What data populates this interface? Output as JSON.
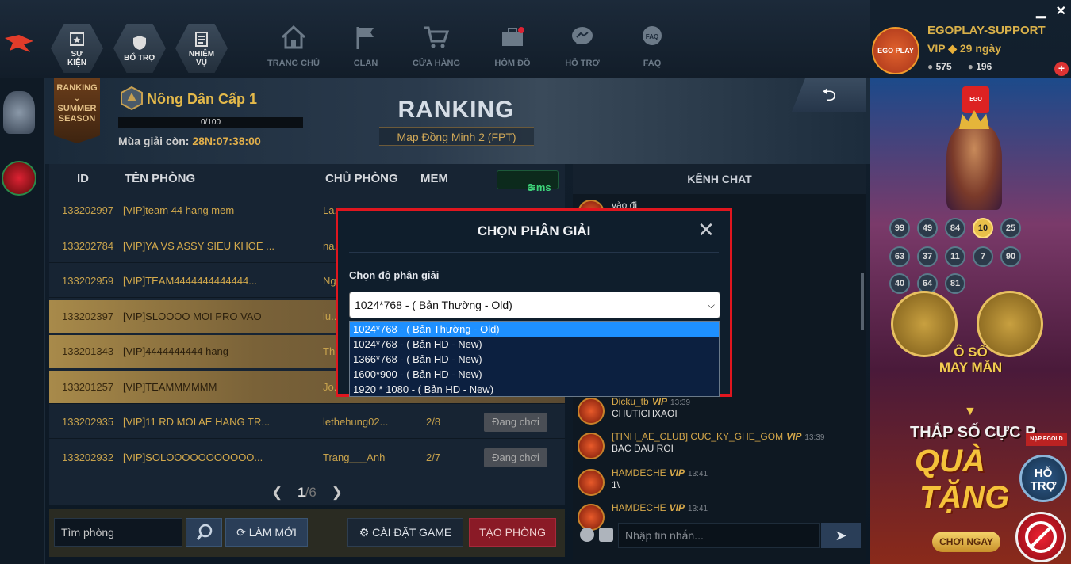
{
  "window": {
    "minimize": "▁",
    "close": "✕"
  },
  "hex_buttons": [
    {
      "label1": "SỰ",
      "label2": "KIỆN"
    },
    {
      "label1": "BỔ TRỢ",
      "label2": ""
    },
    {
      "label1": "NHIỆM",
      "label2": "VỤ"
    }
  ],
  "nav": [
    "TRANG CHỦ",
    "CLAN",
    "CỬA HÀNG",
    "HÒM ĐỒ",
    "HỖ TRỢ",
    "FAQ"
  ],
  "profile": {
    "name": "EGOPLAY-SUPPORT",
    "vip_label": "VIP",
    "vip_days": "29 ngày",
    "coin1": "575",
    "coin2": "196",
    "avatar_text": "EGO PLAY"
  },
  "ranking": {
    "season_badge": [
      "RANKING",
      "SUMMER",
      "SEASON"
    ],
    "rank_name": "Nông Dân Cấp 1",
    "progress_text": "0/100",
    "progress": 0,
    "season_label": "Mùa giải còn:",
    "season_time": "28N:07:38:00",
    "title": "RANKING",
    "map": "Map Đồng Minh 2 (FPT)"
  },
  "table": {
    "headers": {
      "id": "ID",
      "name": "TÊN PHÒNG",
      "owner": "CHỦ PHÒNG",
      "mem": "MEM"
    },
    "ping": "3 ms",
    "rows": [
      {
        "id": "133202997",
        "name": "[VIP]team 44 hang mem",
        "owner": "La...",
        "mem": "",
        "btn": ""
      },
      {
        "id": "133202784",
        "name": "[VIP]YA VS ASSY SIEU KHOE ...",
        "owner": "na...",
        "mem": "",
        "btn": ""
      },
      {
        "id": "133202959",
        "name": "[VIP]TEAM4444444444444...",
        "owner": "Ng...",
        "mem": "",
        "btn": ""
      },
      {
        "id": "133202397",
        "name": "[VIP]SLOOOO MOI PRO VAO",
        "owner": "lu...",
        "mem": "",
        "btn": ""
      },
      {
        "id": "133201343",
        "name": "[VIP]4444444444 hang",
        "owner": "Th...",
        "mem": "",
        "btn": ""
      },
      {
        "id": "133201257",
        "name": "[VIP]TEAMMMMMM",
        "owner": "Jo...",
        "mem": "",
        "btn": ""
      },
      {
        "id": "133202935",
        "name": "[VIP]11 RD MOI AE HANG TR...",
        "owner": "lethehung02...",
        "mem": "2/8",
        "btn": "Đang chơi"
      },
      {
        "id": "133202932",
        "name": "[VIP]SOLOOOOOOOOOOO...",
        "owner": "Trang___Anh",
        "mem": "2/7",
        "btn": "Đang chơi"
      }
    ],
    "page_current": "1",
    "page_sep": "/",
    "page_total": "6"
  },
  "controls": {
    "search_placeholder": "Tìm phòng",
    "refresh": "LÀM MỚI",
    "settings": "CÀI ĐẶT GAME",
    "create": "TẠO PHÒNG"
  },
  "chat": {
    "title": "KÊNH CHAT",
    "messages": [
      {
        "name": "",
        "vip": "",
        "time": "",
        "text": "vào đi"
      },
      {
        "name": "...rks99",
        "vip": "",
        "time": "13:32",
        "text": ""
      },
      {
        "name": "...rks99",
        "vip": "",
        "time": "13:33",
        "text": ""
      },
      {
        "name": "Dicku_tb",
        "vip": "VIP",
        "time": "13:39",
        "text": "CHUTICHXAOI"
      },
      {
        "name": "[TINH_AE_CLUB] CUC_KY_GHE_GOM",
        "vip": "VIP",
        "time": "13:39",
        "text": "BAC DAU ROI"
      },
      {
        "name": "HAMDECHE",
        "vip": "VIP",
        "time": "13:41",
        "text": "1\\"
      },
      {
        "name": "HAMDECHE",
        "vip": "VIP",
        "time": "13:41",
        "text": ""
      }
    ],
    "input_placeholder": "Nhập tin nhắn...",
    "send": "➤"
  },
  "promo": {
    "logo": "EGO PLAY",
    "balls_row1": [
      "99",
      "49",
      "84",
      "10",
      "25"
    ],
    "balls_row2": [
      "63",
      "37",
      "11",
      "7",
      "90"
    ],
    "balls_row3": [
      "40",
      "64",
      "81"
    ],
    "title_line1": "Ô SỐ",
    "title_line2": "MAY MẮN",
    "line3": "THẮP SỐ CỰC P",
    "line4": "QUÀ",
    "line5": "TẶNG",
    "button": "CHƠI NGAY",
    "napegold": "NẠP EGOLD",
    "hotro_1": "HỖ",
    "hotro_2": "TRỢ"
  },
  "modal": {
    "title": "CHỌN PHÂN GIẢI",
    "close": "✕",
    "label": "Chọn độ phân giải",
    "selected": "1024*768 - ( Bản Thường - Old)",
    "options": [
      "1024*768 - ( Bản Thường - Old)",
      "1024*768 - ( Bản HD - New)",
      "1366*768 - ( Bản HD - New)",
      "1600*900 - ( Bản HD - New)",
      "1920 * 1080 - ( Bản HD - New)"
    ]
  },
  "colors": {
    "accent_red": "#e0161f",
    "gold": "#d8b04a",
    "selected_option": "#1e90ff"
  }
}
